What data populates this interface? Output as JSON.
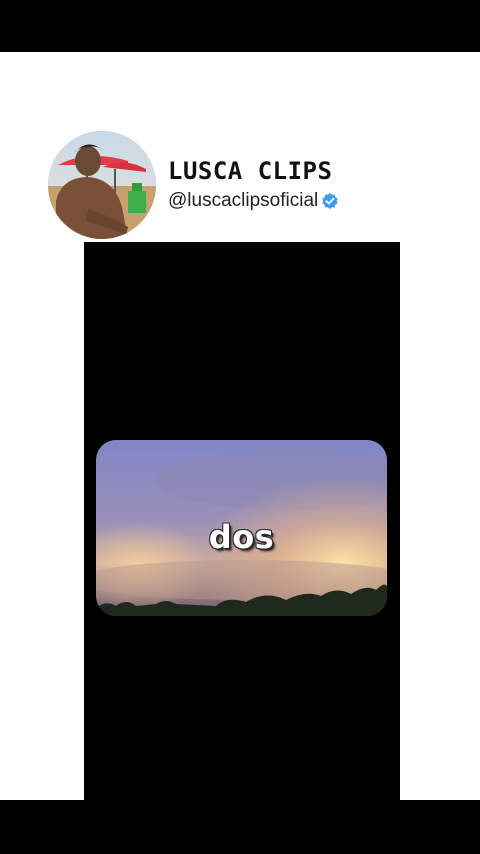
{
  "profile": {
    "display_name": "LUSCA CLIPS",
    "handle": "@luscaclipsoficial",
    "verified": true,
    "avatar_icon": "avatar-photo-beach"
  },
  "video": {
    "caption": "dos",
    "scene": "sky-clouds-city-lights"
  },
  "colors": {
    "background": "#000000",
    "panel": "#ffffff",
    "verified_badge": "#3d9bf0"
  }
}
